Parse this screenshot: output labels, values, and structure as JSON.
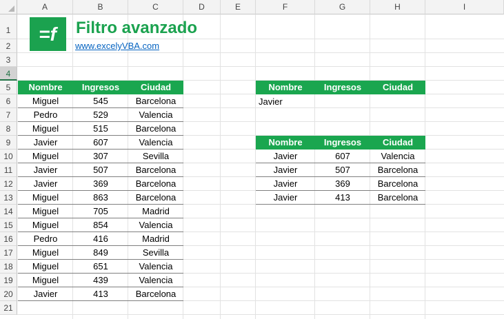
{
  "columns": [
    "A",
    "B",
    "C",
    "D",
    "E",
    "F",
    "G",
    "H",
    "I"
  ],
  "rows": [
    "1",
    "2",
    "3",
    "4",
    "5",
    "6",
    "7",
    "8",
    "9",
    "10",
    "11",
    "12",
    "13",
    "14",
    "15",
    "16",
    "17",
    "18",
    "19",
    "20",
    "21"
  ],
  "header": {
    "logo_glyph": "=f",
    "title": "Filtro avanzado",
    "link": "www.excelyVBA.com"
  },
  "source_table": {
    "headers": [
      "Nombre",
      "Ingresos",
      "Ciudad"
    ],
    "rows": [
      [
        "Miguel",
        "545",
        "Barcelona"
      ],
      [
        "Pedro",
        "529",
        "Valencia"
      ],
      [
        "Miguel",
        "515",
        "Barcelona"
      ],
      [
        "Javier",
        "607",
        "Valencia"
      ],
      [
        "Miguel",
        "307",
        "Sevilla"
      ],
      [
        "Javier",
        "507",
        "Barcelona"
      ],
      [
        "Javier",
        "369",
        "Barcelona"
      ],
      [
        "Miguel",
        "863",
        "Barcelona"
      ],
      [
        "Miguel",
        "705",
        "Madrid"
      ],
      [
        "Miguel",
        "854",
        "Valencia"
      ],
      [
        "Pedro",
        "416",
        "Madrid"
      ],
      [
        "Miguel",
        "849",
        "Sevilla"
      ],
      [
        "Miguel",
        "651",
        "Valencia"
      ],
      [
        "Miguel",
        "439",
        "Valencia"
      ],
      [
        "Javier",
        "413",
        "Barcelona"
      ]
    ]
  },
  "criteria_table": {
    "headers": [
      "Nombre",
      "Ingresos",
      "Ciudad"
    ],
    "value": "Javier"
  },
  "result_table": {
    "headers": [
      "Nombre",
      "Ingresos",
      "Ciudad"
    ],
    "rows": [
      [
        "Javier",
        "607",
        "Valencia"
      ],
      [
        "Javier",
        "507",
        "Barcelona"
      ],
      [
        "Javier",
        "369",
        "Barcelona"
      ],
      [
        "Javier",
        "413",
        "Barcelona"
      ]
    ]
  },
  "colors": {
    "brand_green": "#1aa64f",
    "link_blue": "#0563c1"
  }
}
